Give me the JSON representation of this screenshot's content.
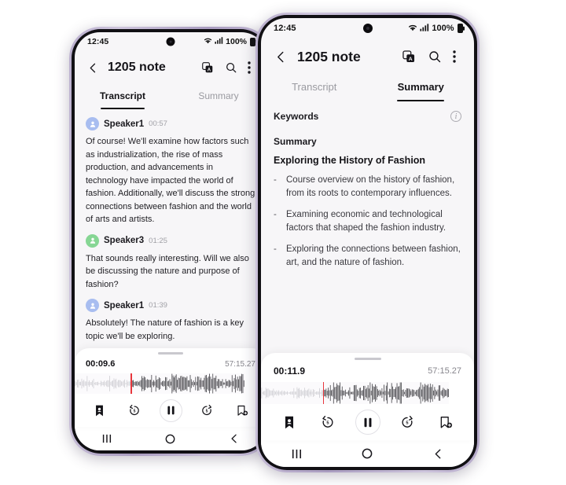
{
  "phone_left": {
    "status": {
      "clock": "12:45",
      "battery_text": "100%",
      "wifi_icon": "wifi-icon",
      "signal_icon": "signal-bars-icon",
      "battery_icon": "battery-icon"
    },
    "appbar": {
      "back_icon": "back-chevron-icon",
      "title": "1205 note",
      "translate_icon": "translate-icon",
      "search_icon": "search-icon",
      "more_icon": "more-vertical-icon"
    },
    "tabs": [
      {
        "label": "Transcript",
        "active": true
      },
      {
        "label": "Summary",
        "active": false
      }
    ],
    "transcript": [
      {
        "speaker": "Speaker1",
        "time": "00:57",
        "avatar_color": "#a8bdf0",
        "text": "Of course! We'll examine how factors such as industrialization, the rise of mass production, and advancements in technology have impacted the world of fashion. Additionally, we'll discuss the strong connections between fashion and the world of arts and artists."
      },
      {
        "speaker": "Speaker3",
        "time": "01:25",
        "avatar_color": "#86d694",
        "text": "That sounds really interesting. Will we also be discussing the nature and purpose of fashion?"
      },
      {
        "speaker": "Speaker1",
        "time": "01:39",
        "avatar_color": "#a8bdf0",
        "text": "Absolutely! The nature of fashion is a key topic we'll be exploring."
      }
    ],
    "player": {
      "current_time": "00:09.6",
      "total_time": "57:15.27",
      "playhead_percent": 33,
      "playhead_color": "#e8363c",
      "controls": [
        {
          "name": "bookmark-filled-icon"
        },
        {
          "name": "rewind-5-icon",
          "label": "5"
        },
        {
          "name": "pause-icon"
        },
        {
          "name": "forward-5-icon",
          "label": "5"
        },
        {
          "name": "add-bookmark-icon"
        }
      ]
    },
    "navbar": [
      {
        "name": "recents-icon"
      },
      {
        "name": "home-icon"
      },
      {
        "name": "back-icon"
      }
    ]
  },
  "phone_right": {
    "status": {
      "clock": "12:45",
      "battery_text": "100%",
      "wifi_icon": "wifi-icon",
      "signal_icon": "signal-bars-icon",
      "battery_icon": "battery-icon"
    },
    "appbar": {
      "back_icon": "back-chevron-icon",
      "title": "1205 note",
      "translate_icon": "translate-icon",
      "search_icon": "search-icon",
      "more_icon": "more-vertical-icon"
    },
    "tabs": [
      {
        "label": "Transcript",
        "active": false
      },
      {
        "label": "Summary",
        "active": true
      }
    ],
    "summary": {
      "keywords_label": "Keywords",
      "info_icon": "info-icon",
      "info_glyph": "i",
      "summary_label": "Summary",
      "heading": "Exploring the History of Fashion",
      "bullet_marker": "-",
      "bullets": [
        "Course overview on the history of fashion, from its roots to contemporary influences.",
        "Examining economic and technological factors that shaped the fashion industry.",
        "Exploring the connections between fashion, art, and the nature of fashion."
      ]
    },
    "player": {
      "current_time": "00:11.9",
      "total_time": "57:15.27",
      "playhead_percent": 33,
      "playhead_color": "#e8363c",
      "controls": [
        {
          "name": "bookmark-filled-icon"
        },
        {
          "name": "rewind-5-icon",
          "label": "5"
        },
        {
          "name": "pause-icon"
        },
        {
          "name": "forward-5-icon",
          "label": "5"
        },
        {
          "name": "add-bookmark-icon"
        }
      ]
    },
    "navbar": [
      {
        "name": "recents-icon"
      },
      {
        "name": "home-icon"
      },
      {
        "name": "back-icon"
      }
    ]
  }
}
